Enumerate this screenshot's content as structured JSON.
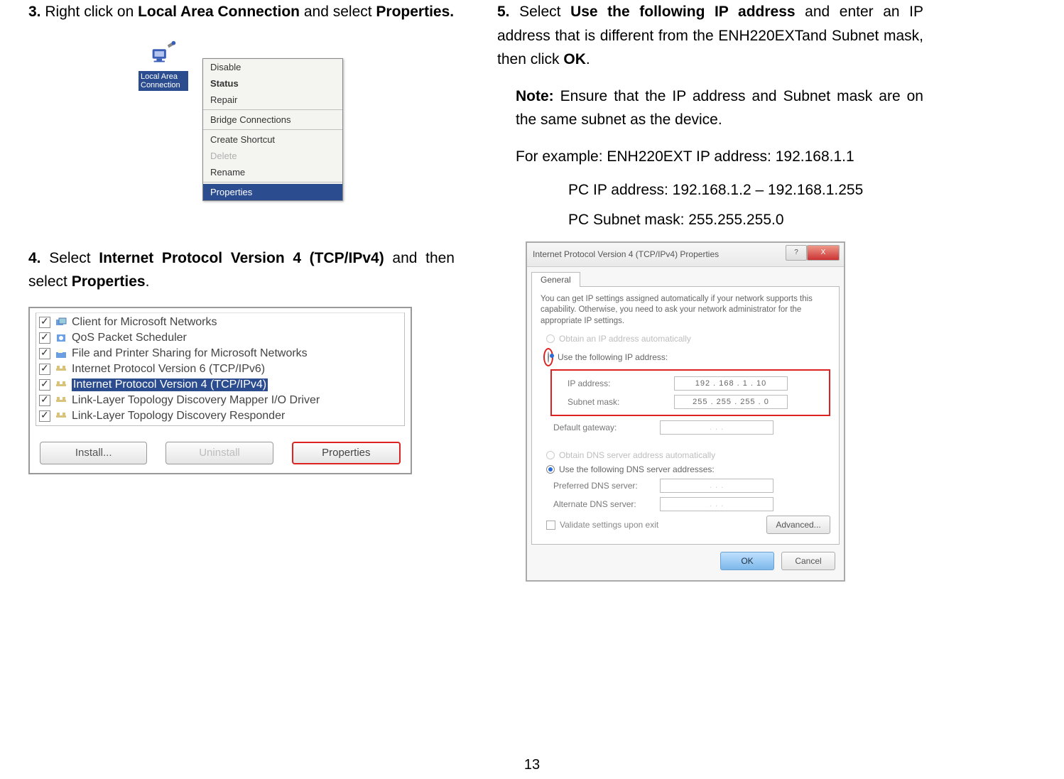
{
  "step3": {
    "num": "3.",
    "text_pre": "Right click on ",
    "bold1": "Local Area Connection",
    "text_mid": " and select ",
    "bold2": "Properties.",
    "fig": {
      "icon_label": "Local Area Connection",
      "menu": {
        "i_disable": "Disable",
        "i_status": "Status",
        "i_repair": "Repair",
        "i_bridge": "Bridge Connections",
        "i_shortcut": "Create Shortcut",
        "i_delete": "Delete",
        "i_rename": "Rename",
        "i_properties": "Properties"
      }
    }
  },
  "step4": {
    "num": "4.",
    "text_pre": "Select ",
    "bold1": "Internet Protocol Version 4 (TCP/IPv4)",
    "text_mid": " and then select ",
    "bold2": "Properties",
    "text_post": ".",
    "list": {
      "i0": "Client for Microsoft Networks",
      "i1": "QoS Packet Scheduler",
      "i2": "File and Printer Sharing for Microsoft Networks",
      "i3": "Internet Protocol Version 6 (TCP/IPv6)",
      "i4": "Internet Protocol Version 4 (TCP/IPv4)",
      "i5": "Link-Layer Topology Discovery Mapper I/O Driver",
      "i6": "Link-Layer Topology Discovery Responder"
    },
    "btn_install": "Install...",
    "btn_uninstall": "Uninstall",
    "btn_properties": "Properties"
  },
  "step5": {
    "num": "5.",
    "text_pre": "Select ",
    "bold1": "Use the following IP address",
    "text_mid": " and enter an IP address that is different from the ENH220EXTand Subnet mask, then click ",
    "bold2": "OK",
    "text_post": ".",
    "note_label": "Note:",
    "note_text": " Ensure that the IP address and Subnet mask are on the same subnet as the device.",
    "example_line": "For example: ENH220EXT IP address: 192.168.1.1",
    "pc_ip": "PC IP address: 192.168.1.2 – 192.168.1.255",
    "pc_mask": "PC Subnet mask: 255.255.255.0"
  },
  "dialog": {
    "title": "Internet Protocol Version 4 (TCP/IPv4) Properties",
    "tab": "General",
    "desc": "You can get IP settings assigned automatically if your network supports this capability. Otherwise, you need to ask your network administrator for the appropriate IP settings.",
    "r_auto": "Obtain an IP address automatically",
    "r_manual": "Use the following IP address:",
    "f_ip": "IP address:",
    "f_mask": "Subnet mask:",
    "f_gw": "Default gateway:",
    "v_ip": "192 . 168 .  1  . 10",
    "v_mask": "255 . 255 . 255 .  0",
    "v_gw": ".       .       .",
    "r_dnsauto": "Obtain DNS server address automatically",
    "r_dnsman": "Use the following DNS server addresses:",
    "f_pdns": "Preferred DNS server:",
    "f_adns": "Alternate DNS server:",
    "v_empty": ".       .       .",
    "chk_validate": "Validate settings upon exit",
    "btn_adv": "Advanced...",
    "btn_ok": "OK",
    "btn_cancel": "Cancel",
    "help_q": "?",
    "close_x": "X"
  },
  "pagenum": "13"
}
